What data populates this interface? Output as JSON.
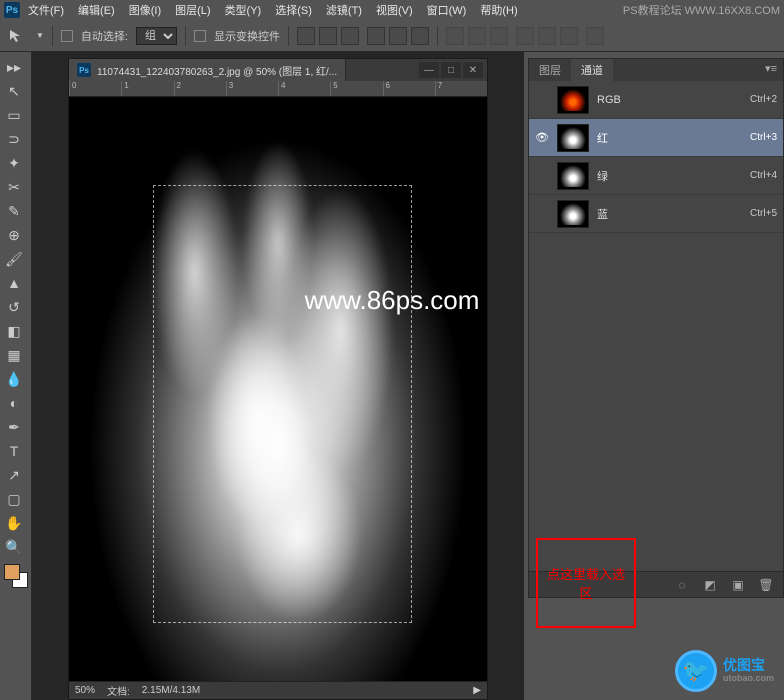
{
  "menubar": {
    "items": [
      "文件(F)",
      "编辑(E)",
      "图像(I)",
      "图层(L)",
      "类型(Y)",
      "选择(S)",
      "滤镜(T)",
      "视图(V)",
      "窗口(W)",
      "帮助(H)"
    ],
    "watermark": "PS教程论坛 WWW.16XX8.COM"
  },
  "optionsbar": {
    "auto_select_label": "自动选择:",
    "group_option": "组",
    "show_transform_label": "显示变换控件"
  },
  "document": {
    "title": "11074431_122403780263_2.jpg @ 50% (图层 1, 红/...",
    "zoom": "50%",
    "doc_size_label": "文档:",
    "doc_size": "2.15M/4.13M",
    "ruler_marks": [
      "0",
      "1",
      "2",
      "3",
      "4",
      "5",
      "6",
      "7"
    ]
  },
  "panel": {
    "tabs": {
      "layers": "图层",
      "channels": "通道"
    },
    "channels": [
      {
        "name": "RGB",
        "shortcut": "Ctrl+2",
        "eye": false,
        "thumb": "rgb",
        "selected": false
      },
      {
        "name": "红",
        "shortcut": "Ctrl+3",
        "eye": true,
        "thumb": "gray",
        "selected": true
      },
      {
        "name": "绿",
        "shortcut": "Ctrl+4",
        "eye": false,
        "thumb": "gray",
        "selected": false
      },
      {
        "name": "蓝",
        "shortcut": "Ctrl+5",
        "eye": false,
        "thumb": "gray",
        "selected": false
      }
    ]
  },
  "annotation": {
    "text": "点这里载入选区"
  },
  "watermark_center": "www.86ps.com",
  "logo": {
    "brand": "优图宝",
    "url": "utobao.com"
  },
  "toolbar_icons": [
    "move",
    "marquee",
    "lasso",
    "wand",
    "crop",
    "eyedrop",
    "heal",
    "brush",
    "stamp",
    "history",
    "eraser",
    "gradient",
    "blur",
    "dodge",
    "pen",
    "type",
    "path",
    "shape",
    "hand",
    "zoom"
  ]
}
